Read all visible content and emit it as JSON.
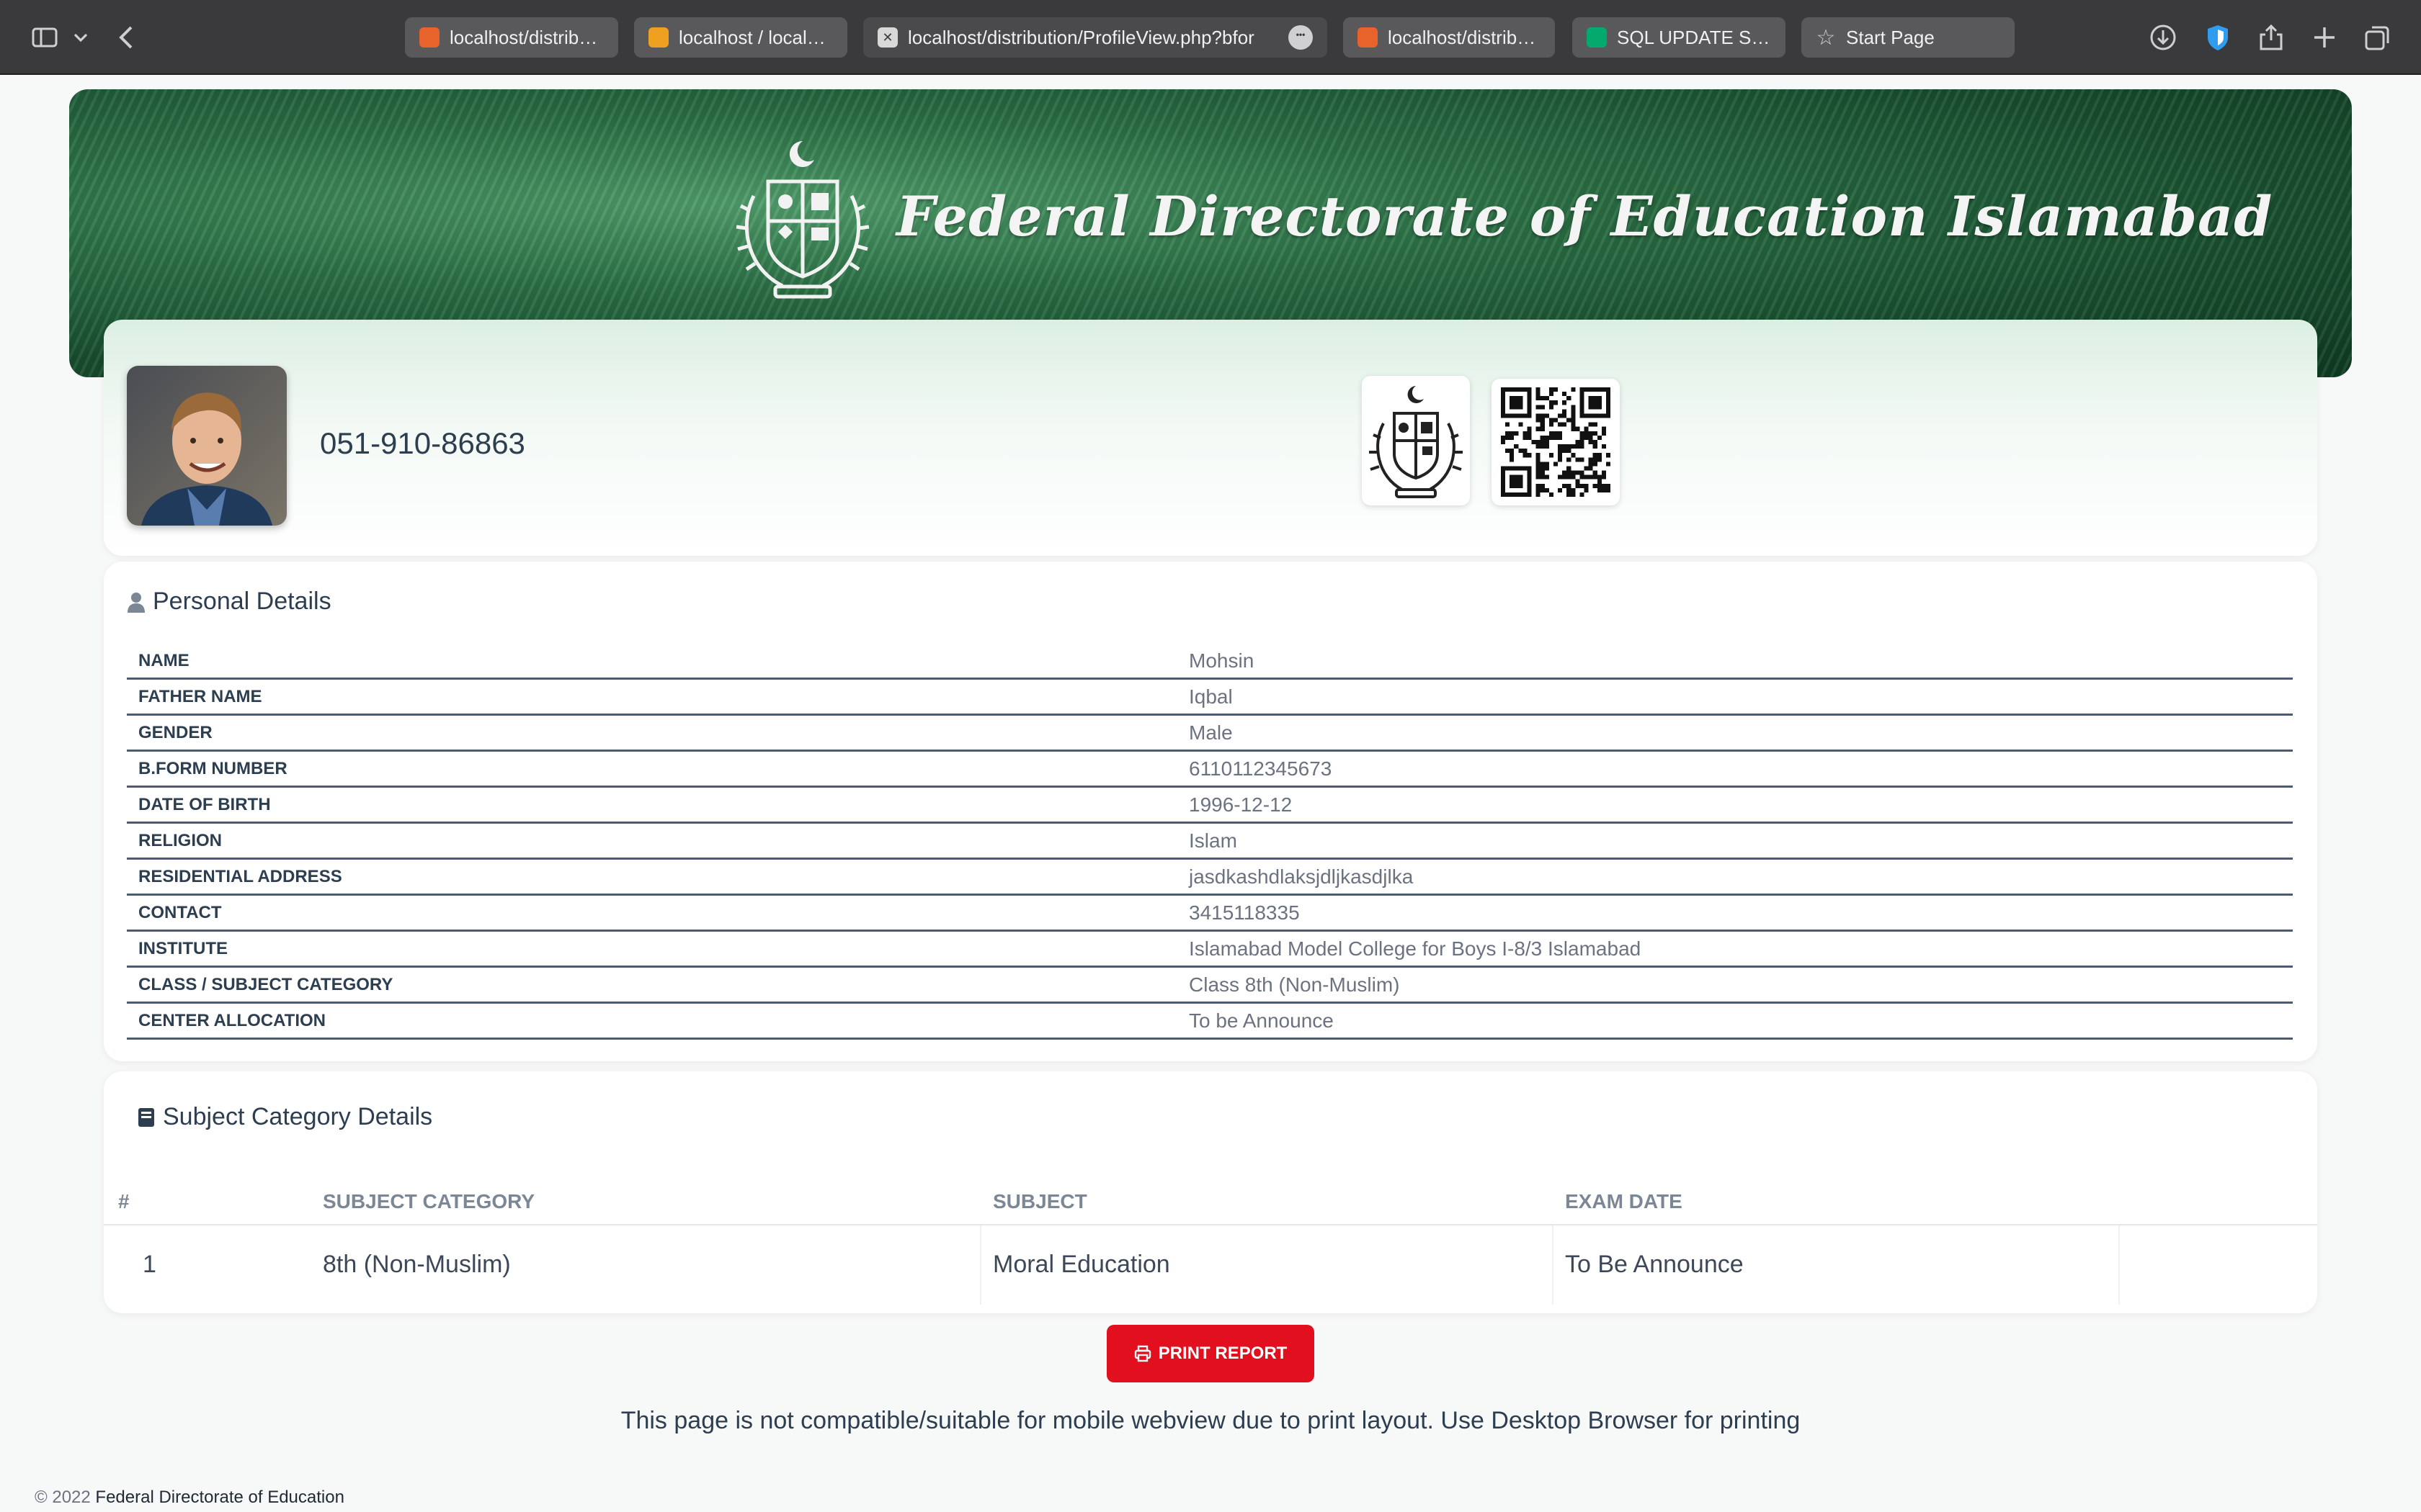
{
  "browser": {
    "tabs": [
      {
        "label": "localhost/distribu…",
        "favicon": "xampp-icon",
        "color": "#e8632b"
      },
      {
        "label": "localhost / localh…",
        "favicon": "phpmyadmin-icon",
        "color": "#f0a020"
      },
      {
        "label": "localhost/distribution/ProfileView.php?bfor",
        "favicon": "close-tab-icon",
        "color": "#d8d8d8"
      },
      {
        "label": "localhost/distribu…",
        "favicon": "xampp-icon",
        "color": "#e8632b"
      },
      {
        "label": "SQL UPDATE Stat…",
        "favicon": "w3schools-icon",
        "color": "#04aa6d"
      },
      {
        "label": "Start Page",
        "favicon": "star-icon",
        "color": "#cfcfd1"
      }
    ],
    "active_tab": 2
  },
  "banner": {
    "title": "Federal Directorate of Education Islamabad"
  },
  "profile": {
    "roll_number": "051-910-86863"
  },
  "personal": {
    "title": "Personal Details",
    "rows": [
      {
        "label": "NAME",
        "value": "Mohsin"
      },
      {
        "label": "FATHER NAME",
        "value": "Iqbal"
      },
      {
        "label": "GENDER",
        "value": "Male"
      },
      {
        "label": "B.FORM NUMBER",
        "value": "6110112345673"
      },
      {
        "label": "DATE OF BIRTH",
        "value": "1996-12-12"
      },
      {
        "label": "RELIGION",
        "value": "Islam"
      },
      {
        "label": "RESIDENTIAL ADDRESS",
        "value": "jasdkashdlaksjdljkasdjlka"
      },
      {
        "label": "CONTACT",
        "value": "3415118335"
      },
      {
        "label": "INSTITUTE",
        "value": "Islamabad Model College for Boys I-8/3 Islamabad"
      },
      {
        "label": "CLASS / SUBJECT CATEGORY",
        "value": "Class 8th (Non-Muslim)"
      },
      {
        "label": "CENTER ALLOCATION",
        "value": "To be Announce"
      }
    ]
  },
  "subjects": {
    "title": "Subject Category Details",
    "headers": [
      "#",
      "SUBJECT CATEGORY",
      "SUBJECT",
      "EXAM DATE"
    ],
    "rows": [
      [
        "1",
        "8th (Non-Muslim)",
        "Moral Education",
        "To Be Announce"
      ]
    ]
  },
  "print_button": "PRINT REPORT",
  "notice": "This page is not compatible/suitable for mobile webview due to print layout. Use Desktop Browser for printing",
  "footer": {
    "copyright": "© 2022",
    "org": "Federal Directorate of Education"
  },
  "colors": {
    "banner_green": "#1f5e38",
    "print_red": "#e2101e",
    "row_border": "#4a5a78"
  }
}
